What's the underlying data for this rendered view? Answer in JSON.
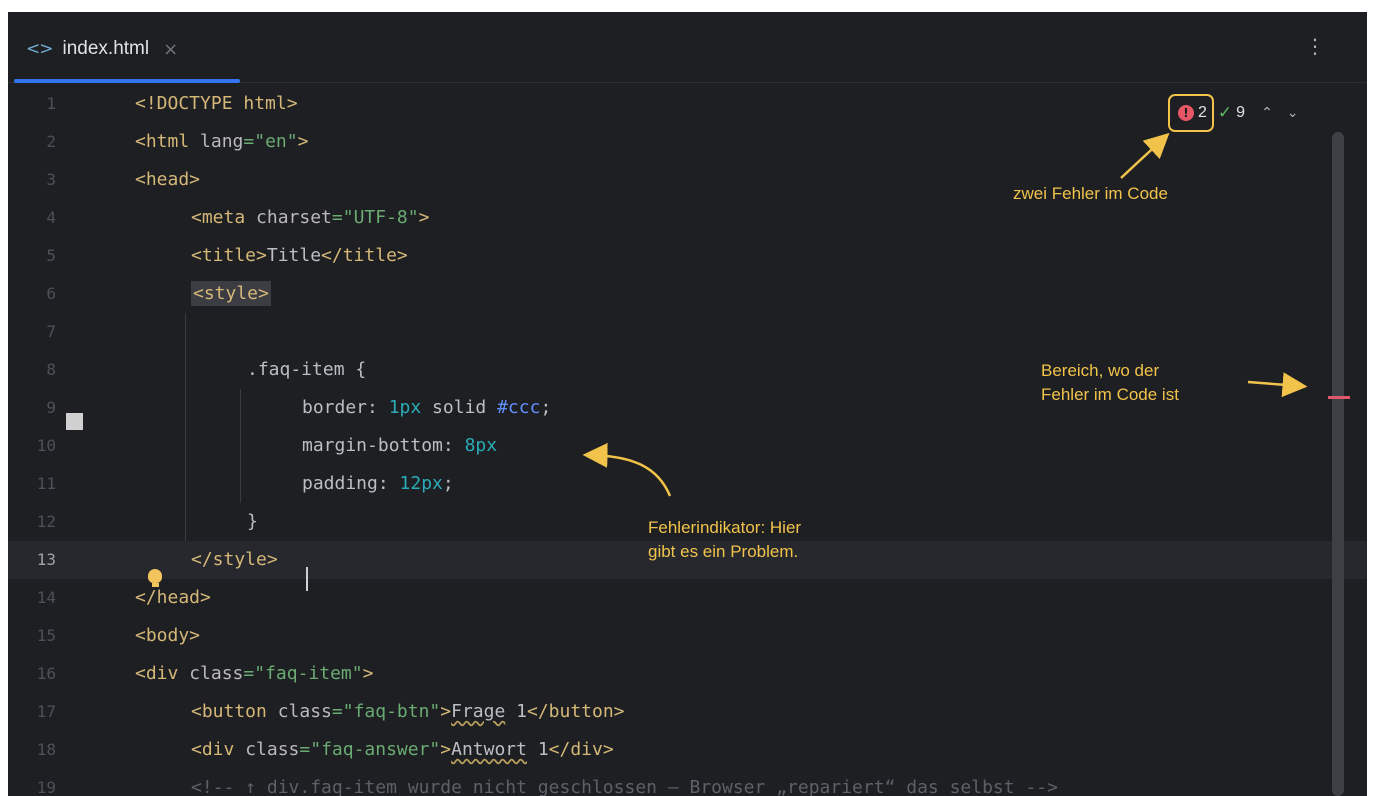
{
  "tab": {
    "icon": "html-file-icon",
    "label": "index.html",
    "close": "×"
  },
  "toolbar": {
    "more": "⋮"
  },
  "inspection": {
    "errors": "2",
    "warnings": "9",
    "error_icon": "!",
    "check_icon": "✓",
    "up": "⌃",
    "down": "⌄"
  },
  "code_lines": [
    {
      "n": "1",
      "text": "<!DOCTYPE html>"
    },
    {
      "n": "2",
      "text": "<html lang=\"en\">"
    },
    {
      "n": "3",
      "text": "<head>"
    },
    {
      "n": "4",
      "text": "<meta charset=\"UTF-8\">"
    },
    {
      "n": "5",
      "text": "<title>Title</title>"
    },
    {
      "n": "6",
      "text": "<style>"
    },
    {
      "n": "7",
      "text": ""
    },
    {
      "n": "8",
      "text": ".faq-item {"
    },
    {
      "n": "9",
      "text": "border: 1px solid #ccc;"
    },
    {
      "n": "10",
      "text": "margin-bottom: 8px"
    },
    {
      "n": "11",
      "text": "padding: 12px;"
    },
    {
      "n": "12",
      "text": "}"
    },
    {
      "n": "13",
      "text": "</style>"
    },
    {
      "n": "14",
      "text": "</head>"
    },
    {
      "n": "15",
      "text": "<body>"
    },
    {
      "n": "16",
      "text": "<div class=\"faq-item\">"
    },
    {
      "n": "17",
      "text": "<button class=\"faq-btn\">Frage 1</button>"
    },
    {
      "n": "18",
      "text": "<div class=\"faq-answer\">Antwort 1</div>"
    },
    {
      "n": "19",
      "text": "<!-- ↑ div.faq-item wurde nicht geschlossen – Browser „repariert“ das selbst -->"
    }
  ],
  "annotations": {
    "errors_note": "zwei Fehler im Code",
    "area_note_1": "Bereich, wo der",
    "area_note_2": "Fehler im Code ist",
    "indicator_note_1": "Fehlerindikator: Hier",
    "indicator_note_2": "gibt es ein Problem."
  },
  "colors": {
    "accent": "#3574f0",
    "annotation": "#f1c34a",
    "error": "#e55765"
  }
}
